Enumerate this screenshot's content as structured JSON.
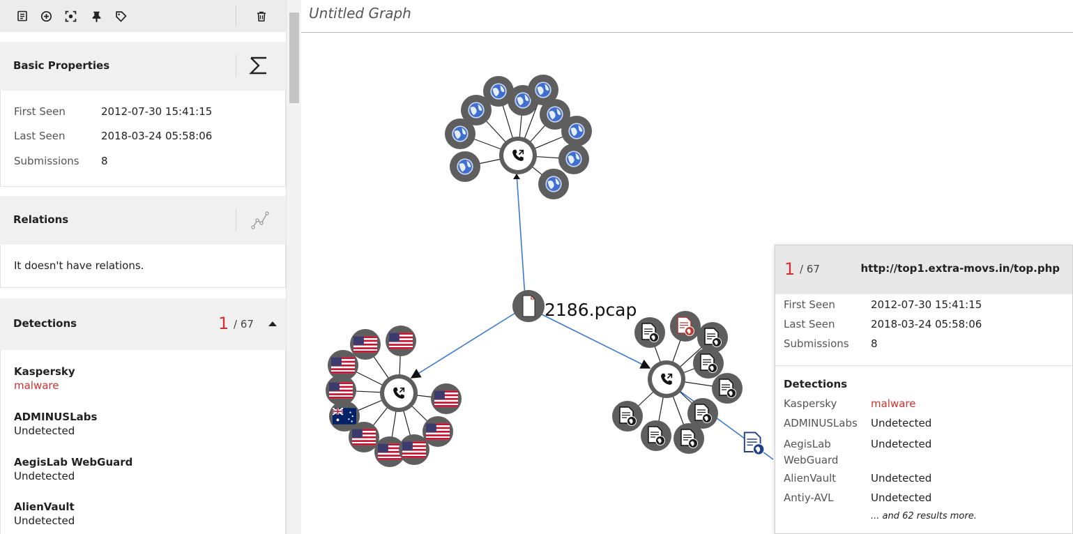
{
  "graph_title": "Untitled Graph",
  "toolbar": {
    "icons": [
      "notes-icon",
      "add-circle-icon",
      "focus-icon",
      "pin-icon",
      "tag-icon",
      "trash-icon"
    ]
  },
  "basic": {
    "title": "Basic Properties",
    "rows": [
      {
        "k": "First Seen",
        "v": "2012-07-30 15:41:15"
      },
      {
        "k": "Last Seen",
        "v": "2018-03-24 05:58:06"
      },
      {
        "k": "Submissions",
        "v": "8"
      }
    ]
  },
  "relations": {
    "title": "Relations",
    "empty_text": "It doesn't have relations."
  },
  "detections": {
    "title": "Detections",
    "positives": "1",
    "total": "/ 67",
    "items": [
      {
        "engine": "Kaspersky",
        "result": "malware",
        "malicious": true
      },
      {
        "engine": "ADMINUSLabs",
        "result": "Undetected",
        "malicious": false
      },
      {
        "engine": "AegisLab WebGuard",
        "result": "Undetected",
        "malicious": false
      },
      {
        "engine": "AlienVault",
        "result": "Undetected",
        "malicious": false
      }
    ]
  },
  "graph": {
    "center_label": "2186.pcap"
  },
  "card": {
    "positives": "1",
    "total": "/ 67",
    "url": "http://top1.extra-movs.in/top.php",
    "rows": [
      {
        "k": "First Seen",
        "v": "2012-07-30 15:41:15"
      },
      {
        "k": "Last Seen",
        "v": "2018-03-24 05:58:06"
      },
      {
        "k": "Submissions",
        "v": "8"
      }
    ],
    "det_title": "Detections",
    "det_rows": [
      {
        "k": "Kaspersky",
        "v": "malware",
        "malicious": true
      },
      {
        "k": "ADMINUSLabs",
        "v": "Undetected",
        "malicious": false
      },
      {
        "k": "AegisLab WebGuard",
        "v": "Undetected",
        "malicious": false
      },
      {
        "k": "AlienVault",
        "v": "Undetected",
        "malicious": false
      },
      {
        "k": "Antiy-AVL",
        "v": "Undetected",
        "malicious": false
      }
    ],
    "more": "... and 62 results more."
  },
  "colors": {
    "malicious": "#d32f2f",
    "edge_blue": "#3a78d6",
    "node_ring": "#5a5a5a"
  }
}
